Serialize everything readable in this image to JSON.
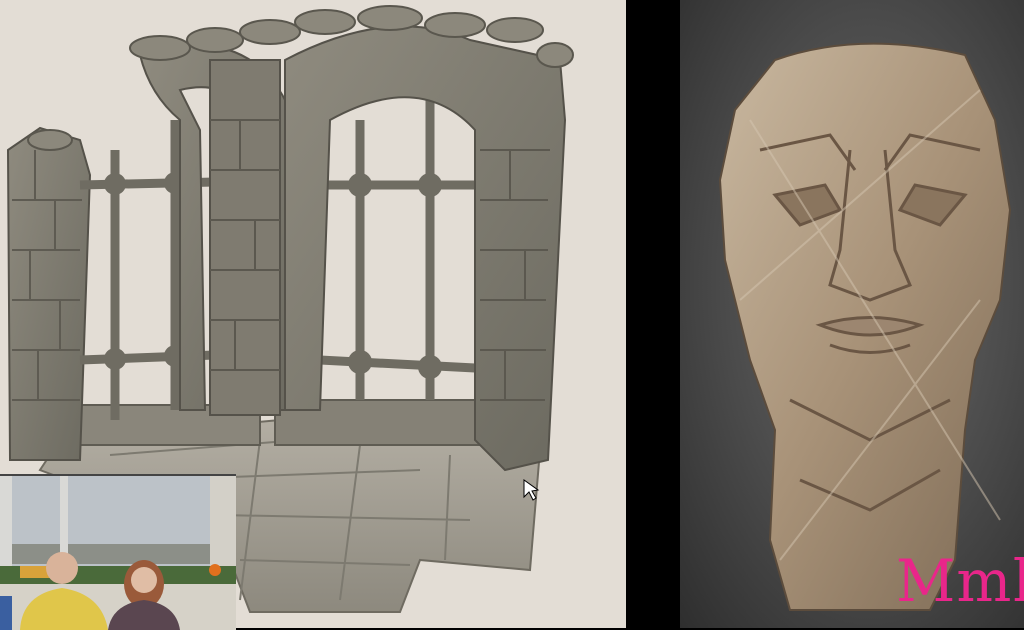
{
  "caption": {
    "text": "Mmh",
    "color": "#e9268a"
  },
  "scenes": {
    "dungeon": {
      "name": "stone-arch-window-model"
    },
    "head": {
      "name": "sculpted-head-model"
    },
    "webcam": {
      "name": "presenter-webcam-overlay"
    }
  },
  "icons": {
    "cursor": "mouse-pointer-icon"
  },
  "colors": {
    "left_background": "#e3ddd5",
    "right_background": "#4a4a4a",
    "stone": "#8a8577",
    "wood": "#b8a68e"
  }
}
